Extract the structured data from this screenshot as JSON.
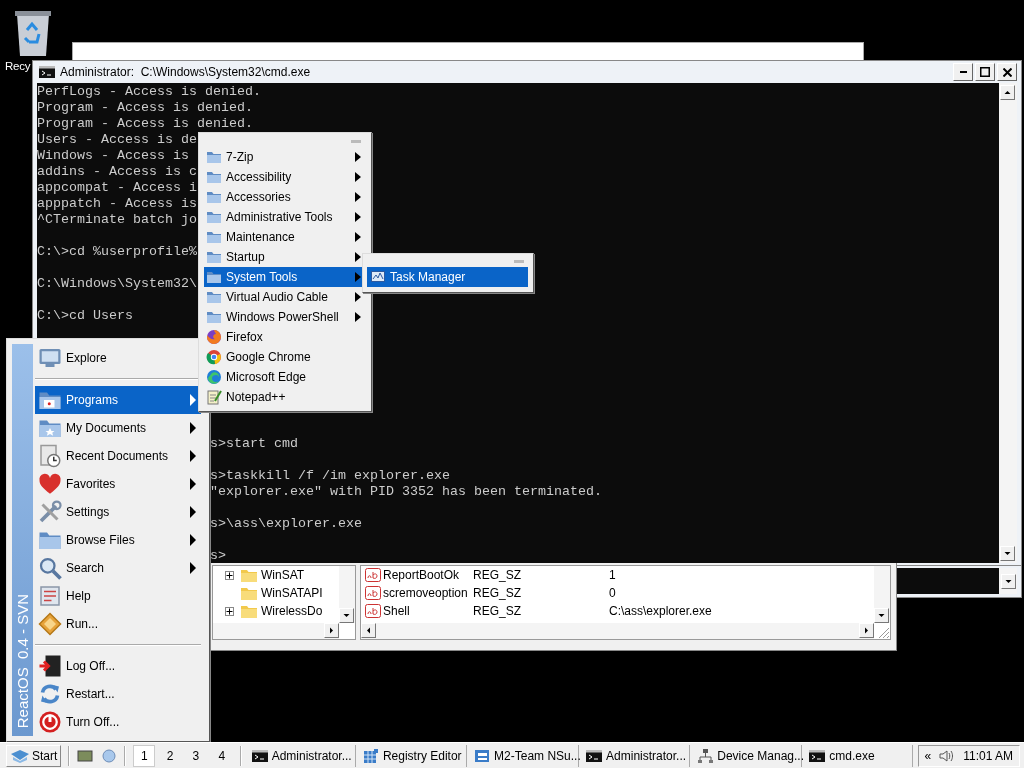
{
  "desktop_icons": [
    {
      "label": "Recy"
    }
  ],
  "console_window": {
    "title": "Administrator:  C:\\Windows\\System32\\cmd.exe",
    "output_blocks": [
      [
        "PerfLogs - Access is denied.",
        "Program - Access is denied.",
        "Program - Access is denied.",
        "Users - Access is de",
        "Windows - Access is",
        "addins - Access is c",
        "appcompat - Access i",
        "apppatch - Access is",
        "^CTerminate batch jo"
      ],
      [
        "C:\\>cd %userprofile%"
      ],
      [
        "C:\\Windows\\System32\\"
      ],
      [
        "C:\\>cd Users"
      ]
    ],
    "output_beside_menu": [
      [
        "s>start cmd"
      ],
      [
        "s>taskkill /f /im explorer.exe",
        "\"explorer.exe\" with PID 3352 has been terminated."
      ],
      [
        "s>\\ass\\explorer.exe"
      ],
      [
        "s>"
      ]
    ]
  },
  "registry_editor": {
    "tree": [
      {
        "label": "WinSAT",
        "expandable": true
      },
      {
        "label": "WinSATAPI",
        "expandable": false
      },
      {
        "label": "WirelessDo",
        "expandable": true
      }
    ],
    "values": [
      {
        "name": "ReportBootOk",
        "type": "REG_SZ",
        "data": "1"
      },
      {
        "name": "scremoveoption",
        "type": "REG_SZ",
        "data": "0"
      },
      {
        "name": "Shell",
        "type": "REG_SZ",
        "data": "C:\\ass\\explorer.exe"
      }
    ]
  },
  "start_menu": {
    "banner": "ReactOS  0.4 - SVN",
    "sections": [
      [
        {
          "label": "Explore",
          "kind": "computer",
          "submenu": false,
          "selected": false
        }
      ],
      [
        {
          "label": "Programs",
          "kind": "programs",
          "submenu": true,
          "selected": true
        },
        {
          "label": "My Documents",
          "kind": "documents",
          "submenu": true,
          "selected": false
        },
        {
          "label": "Recent Documents",
          "kind": "recent",
          "submenu": true,
          "selected": false
        },
        {
          "label": "Favorites",
          "kind": "heart",
          "submenu": true,
          "selected": false
        },
        {
          "label": "Settings",
          "kind": "tools",
          "submenu": true,
          "selected": false
        },
        {
          "label": "Browse Files",
          "kind": "folder",
          "submenu": true,
          "selected": false
        },
        {
          "label": "Search",
          "kind": "search",
          "submenu": true,
          "selected": false
        },
        {
          "label": "Help",
          "kind": "book",
          "submenu": false,
          "selected": false
        },
        {
          "label": "Run...",
          "kind": "run",
          "submenu": false,
          "selected": false
        }
      ],
      [
        {
          "label": "Log Off...",
          "kind": "logoff",
          "submenu": false,
          "selected": false
        },
        {
          "label": "Restart...",
          "kind": "restart",
          "submenu": false,
          "selected": false
        },
        {
          "label": "Turn Off...",
          "kind": "power",
          "submenu": false,
          "selected": false
        }
      ]
    ]
  },
  "programs_menu": {
    "items": [
      {
        "label": "7-Zip",
        "kind": "folder",
        "selected": false
      },
      {
        "label": "Accessibility",
        "kind": "folder",
        "selected": false
      },
      {
        "label": "Accessories",
        "kind": "folder",
        "selected": false
      },
      {
        "label": "Administrative Tools",
        "kind": "folder",
        "selected": false
      },
      {
        "label": "Maintenance",
        "kind": "folder",
        "selected": false
      },
      {
        "label": "Startup",
        "kind": "folder",
        "selected": false
      },
      {
        "label": "System Tools",
        "kind": "folder",
        "selected": true
      },
      {
        "label": "Virtual Audio Cable",
        "kind": "folder",
        "selected": false
      },
      {
        "label": "Windows PowerShell",
        "kind": "folder",
        "selected": false
      },
      {
        "label": "Firefox",
        "kind": "firefox",
        "selected": false
      },
      {
        "label": "Google Chrome",
        "kind": "chrome",
        "selected": false
      },
      {
        "label": "Microsoft Edge",
        "kind": "edge",
        "selected": false
      },
      {
        "label": "Notepad++",
        "kind": "notepad",
        "selected": false
      }
    ]
  },
  "system_tools_menu": {
    "items": [
      {
        "label": "Task Manager",
        "kind": "taskmgr",
        "selected": true
      }
    ]
  },
  "taskbar": {
    "start": "Start",
    "desktops": [
      {
        "label": "1",
        "selected": true
      },
      {
        "label": "2",
        "selected": false
      },
      {
        "label": "3",
        "selected": false
      },
      {
        "label": "4",
        "selected": false
      }
    ],
    "tasks": [
      {
        "label": "Administrator...",
        "kind": "console"
      },
      {
        "label": "Registry Editor",
        "kind": "registry"
      },
      {
        "label": "M2-Team NSu...",
        "kind": "app"
      },
      {
        "label": "Administrator...",
        "kind": "console"
      },
      {
        "label": "Device Manag...",
        "kind": "devices"
      },
      {
        "label": "cmd.exe",
        "kind": "console"
      }
    ],
    "tray": {
      "chevron": "«",
      "clock": "11:01 AM"
    }
  }
}
